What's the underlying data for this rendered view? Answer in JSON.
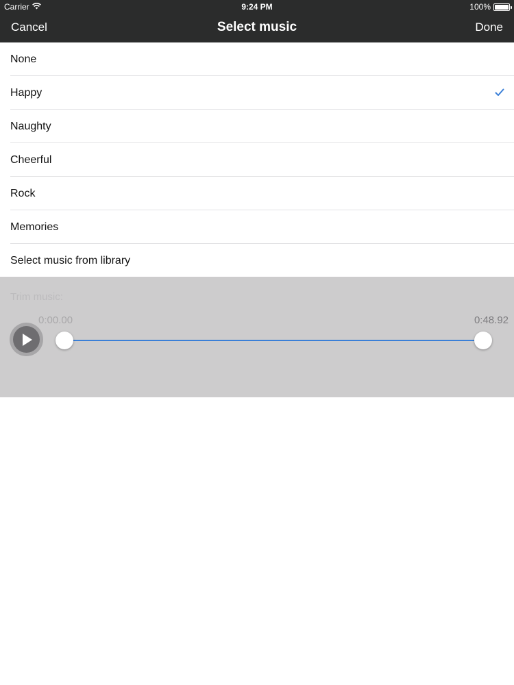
{
  "status_bar": {
    "carrier": "Carrier",
    "time": "9:24 PM",
    "battery": "100%",
    "battery_level": 1.0
  },
  "nav": {
    "cancel_label": "Cancel",
    "title": "Select music",
    "done_label": "Done"
  },
  "music_list": {
    "items": [
      {
        "label": "None",
        "selected": false
      },
      {
        "label": "Happy",
        "selected": true
      },
      {
        "label": "Naughty",
        "selected": false
      },
      {
        "label": "Cheerful",
        "selected": false
      },
      {
        "label": "Rock",
        "selected": false
      },
      {
        "label": "Memories",
        "selected": false
      },
      {
        "label": "Select music from library",
        "selected": false
      }
    ],
    "check_icon": "checkmark-icon"
  },
  "trim": {
    "label": "Trim music:",
    "start_time": "0:00.00",
    "end_time": "0:48.92",
    "play_icon": "play-icon",
    "selection_start": 0.0,
    "selection_end": 1.0
  },
  "colors": {
    "header_bg": "#2b2c2c",
    "accent": "#3a7fd7",
    "panel_bg": "#cdcccd",
    "divider": "#e2e2e4"
  }
}
